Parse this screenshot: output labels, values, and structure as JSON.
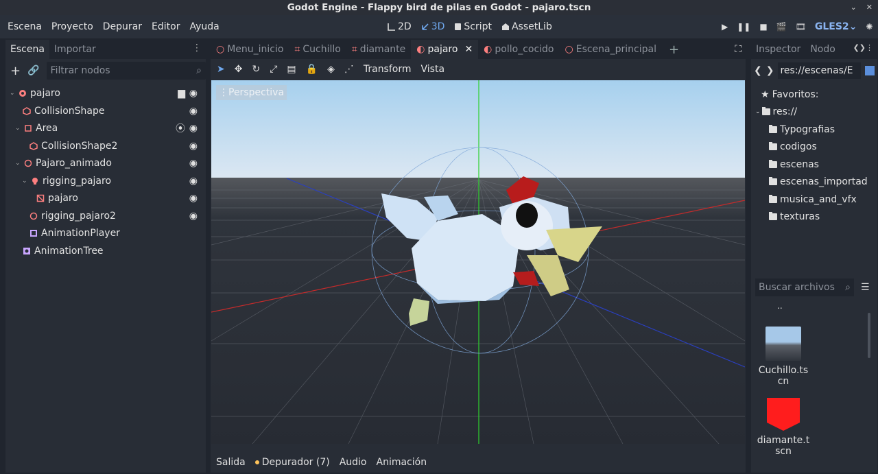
{
  "window": {
    "title": "Godot Engine - Flappy bird de pilas en Godot - pajaro.tscn"
  },
  "menu": [
    "Escena",
    "Proyecto",
    "Depurar",
    "Editor",
    "Ayuda"
  ],
  "modes": [
    {
      "label": "2D",
      "icon": "2d-icon"
    },
    {
      "label": "3D",
      "icon": "3d-icon"
    },
    {
      "label": "Script",
      "icon": "script-icon"
    },
    {
      "label": "AssetLib",
      "icon": "assetlib-icon"
    }
  ],
  "renderer": "GLES2",
  "left_dock": {
    "tabs": [
      "Escena",
      "Importar"
    ],
    "filter_placeholder": "Filtrar nodos",
    "nodes": [
      {
        "label": "pajaro",
        "depth": 0,
        "icon": "node3d-icon"
      },
      {
        "label": "CollisionShape",
        "depth": 1,
        "icon": "collision-shape-icon"
      },
      {
        "label": "Area",
        "depth": 1,
        "icon": "area-icon"
      },
      {
        "label": "CollisionShape2",
        "depth": 2,
        "icon": "collision-shape-icon"
      },
      {
        "label": "Pajaro_animado",
        "depth": 1,
        "icon": "spatial-icon"
      },
      {
        "label": "rigging_pajaro",
        "depth": 2,
        "icon": "skeleton-icon"
      },
      {
        "label": "pajaro",
        "depth": 3,
        "icon": "mesh-instance-icon"
      },
      {
        "label": "rigging_pajaro2",
        "depth": 2,
        "icon": "spatial-icon"
      },
      {
        "label": "AnimationPlayer",
        "depth": 2,
        "icon": "animation-player-icon"
      },
      {
        "label": "AnimationTree",
        "depth": 1,
        "icon": "animation-tree-icon"
      }
    ]
  },
  "scene_tabs": [
    "Menu_inicio",
    "Cuchillo",
    "diamante",
    "pajaro",
    "pollo_cocido",
    "Escena_principal"
  ],
  "viewport_menu": [
    "Transform",
    "Vista"
  ],
  "viewport": {
    "perspective_label": "Perspectiva"
  },
  "bottom_tabs": [
    "Salida",
    "Depurador (7)",
    "Audio",
    "Animación"
  ],
  "right_dock": {
    "tabs": [
      "Inspector",
      "Nodo"
    ],
    "path": "res://escenas/E",
    "favorites": "Favoritos:",
    "root": "res://",
    "folders": [
      "Typografias",
      "codigos",
      "escenas",
      "escenas_importad",
      "musica_and_vfx",
      "texturas"
    ],
    "search_placeholder": "Buscar archivos",
    "parent_dir": "..",
    "files": [
      {
        "line1": "Cuchillo.ts",
        "line2": "cn"
      },
      {
        "line1": "diamante.t",
        "line2": "scn"
      }
    ]
  },
  "colors": {
    "accent": "#6fa8ee",
    "node_icon": "#fc7f7f",
    "diamond": "#ff1d1d",
    "sky_top": "#a9d2ee",
    "ground": "#2b3038"
  }
}
